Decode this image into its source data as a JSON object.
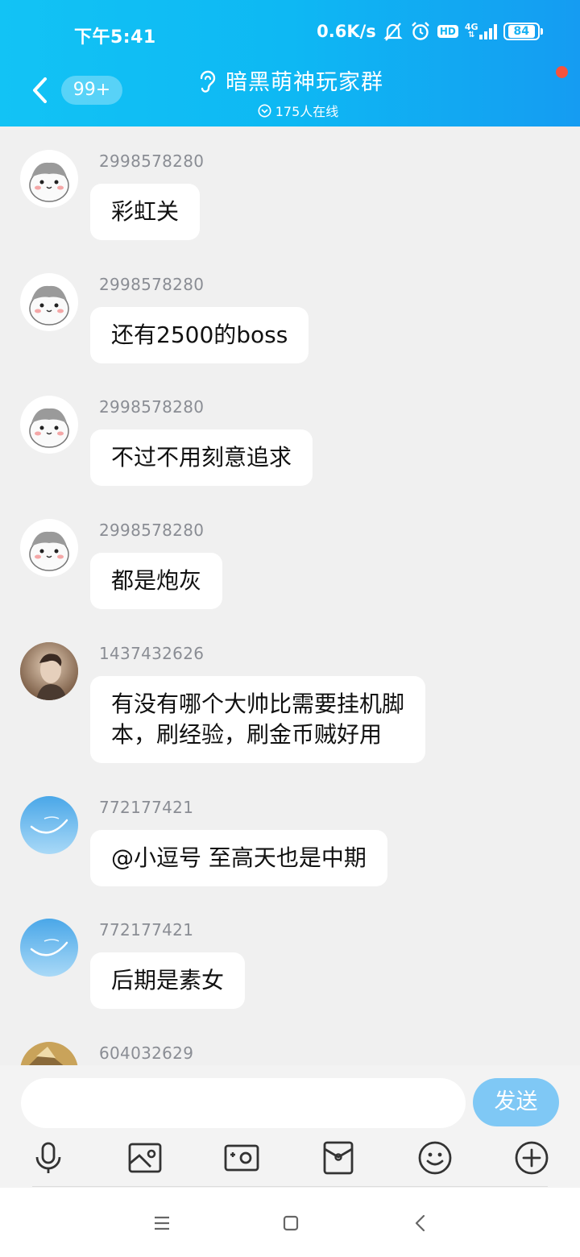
{
  "status_bar": {
    "time": "下午5:41",
    "speed": "0.6K/s",
    "hd": "HD",
    "network": "4G",
    "battery": "84",
    "icons": [
      "mute-icon",
      "alarm-icon",
      "hd-icon",
      "signal-icon",
      "battery-icon"
    ]
  },
  "header": {
    "unread_badge": "99+",
    "title": "暗黑萌神玩家群",
    "online": "175人在线",
    "accent": "#12b4f3"
  },
  "messages": [
    {
      "sender": "2998578280",
      "text": "彩虹关",
      "avatar": "hamster-avatar"
    },
    {
      "sender": "2998578280",
      "text": "还有2500的boss",
      "avatar": "hamster-avatar"
    },
    {
      "sender": "2998578280",
      "text": "不过不用刻意追求",
      "avatar": "hamster-avatar"
    },
    {
      "sender": "2998578280",
      "text": "都是炮灰",
      "avatar": "hamster-avatar"
    },
    {
      "sender": "1437432626",
      "text": "有没有哪个大帅比需要挂机脚\n本，刷经验，刷金币贼好用",
      "avatar": "portrait-avatar"
    },
    {
      "sender": "772177421",
      "text": "@小逗号 至高天也是中期",
      "avatar": "sky-avatar"
    },
    {
      "sender": "772177421",
      "text": "后期是素女",
      "avatar": "sky-avatar"
    },
    {
      "sender": "604032629",
      "text": "",
      "avatar": "landscape-avatar"
    }
  ],
  "input": {
    "value": "",
    "placeholder": "",
    "send_label": "发送"
  },
  "toolbar": [
    "microphone-icon",
    "image-icon",
    "camera-icon",
    "red-packet-icon",
    "emoji-icon",
    "plus-icon"
  ],
  "navbar": [
    "menu-icon",
    "home-icon",
    "back-icon"
  ]
}
